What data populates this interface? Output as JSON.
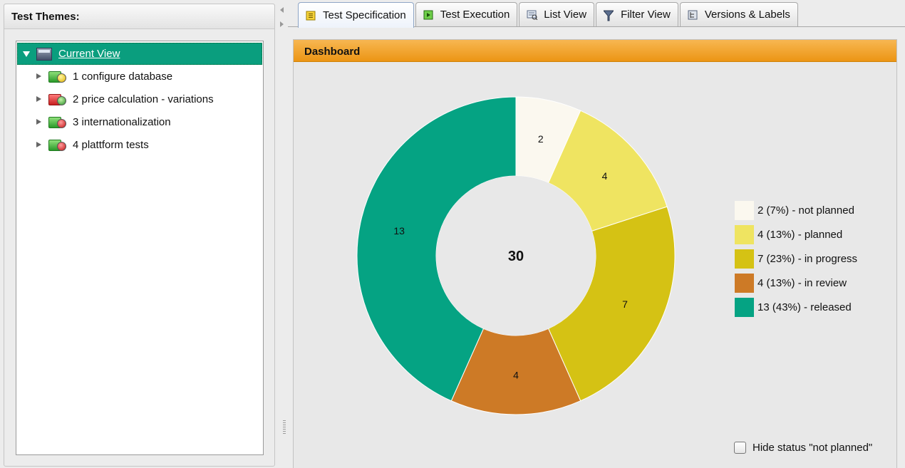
{
  "left_panel": {
    "title": "Test Themes:",
    "root_label": "Current View",
    "items": [
      {
        "label": "1 configure database",
        "icon": "theme-icon-green-yellow"
      },
      {
        "label": "2 price calculation - variations",
        "icon": "theme-icon-red-green"
      },
      {
        "label": "3 internationalization",
        "icon": "theme-icon-green-red"
      },
      {
        "label": "4 plattform tests",
        "icon": "theme-icon-green-red"
      }
    ]
  },
  "tabs": [
    {
      "label": "Test Specification",
      "active": true
    },
    {
      "label": "Test Execution",
      "active": false
    },
    {
      "label": "List View",
      "active": false
    },
    {
      "label": "Filter View",
      "active": false
    },
    {
      "label": "Versions & Labels",
      "active": false
    }
  ],
  "dashboard": {
    "title": "Dashboard",
    "hide_label": "Hide status \"not planned\"",
    "hide_checked": false
  },
  "chart_data": {
    "type": "pie",
    "donut": true,
    "total_label": "30",
    "slices": [
      {
        "value": 2,
        "label": "2",
        "legend": "2 (7%) - not planned",
        "color": "#fbf8ef"
      },
      {
        "value": 4,
        "label": "4",
        "legend": "4 (13%) - planned",
        "color": "#efe461"
      },
      {
        "value": 7,
        "label": "7",
        "legend": "7 (23%) - in progress",
        "color": "#d5c214"
      },
      {
        "value": 4,
        "label": "4",
        "legend": "4 (13%) - in review",
        "color": "#cd7a26"
      },
      {
        "value": 13,
        "label": "13",
        "legend": "13 (43%) - released",
        "color": "#05a383"
      }
    ],
    "legend_position": "right"
  }
}
